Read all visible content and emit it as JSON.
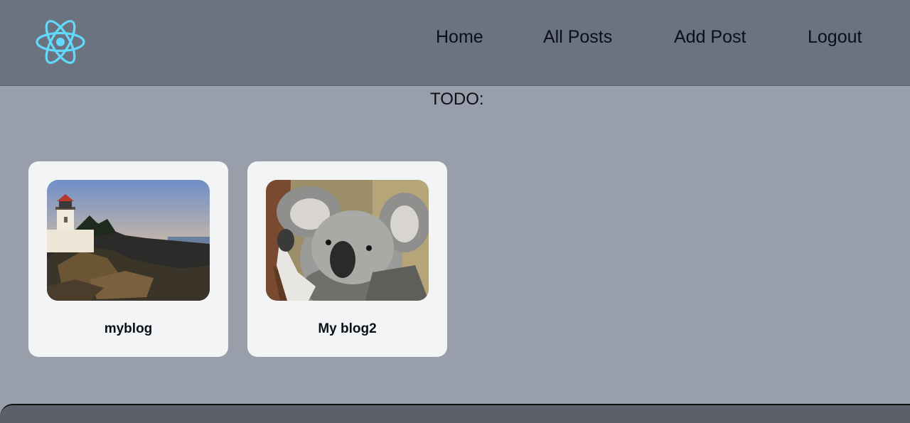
{
  "navbar": {
    "logo_icon": "react-logo-icon",
    "links": [
      {
        "label": "Home"
      },
      {
        "label": "All Posts"
      },
      {
        "label": "Add Post"
      },
      {
        "label": "Logout"
      }
    ]
  },
  "main": {
    "heading": "TODO:",
    "posts": [
      {
        "title": "myblog",
        "image": "lighthouse-photo"
      },
      {
        "title": "My blog2",
        "image": "koala-photo"
      }
    ]
  },
  "colors": {
    "navbar_bg": "#6b7280",
    "page_bg": "#989fab",
    "card_bg": "#f3f4f6",
    "logo": "#61dafb"
  }
}
